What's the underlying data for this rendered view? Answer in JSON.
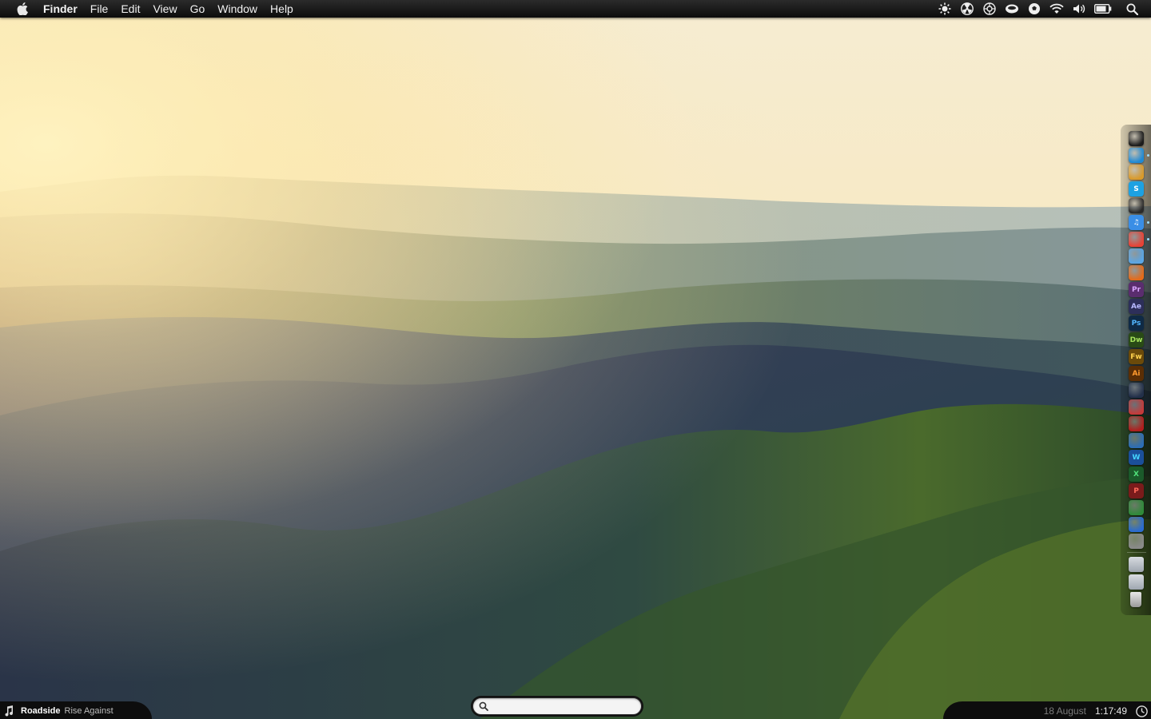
{
  "menubar": {
    "app_name": "Finder",
    "items": [
      "File",
      "Edit",
      "View",
      "Go",
      "Window",
      "Help"
    ],
    "status_icons": [
      "sun-icon",
      "radiation-icon",
      "aperture-icon",
      "cloud-drive-icon",
      "football-icon",
      "wifi-icon",
      "volume-icon",
      "battery-icon",
      "spotlight-icon"
    ]
  },
  "dock": {
    "apps": [
      {
        "name": "apple-icon",
        "label": "",
        "bg": "#1c1c1c",
        "fg": "#ffffff"
      },
      {
        "name": "send-arrow-icon",
        "label": "",
        "bg": "#1e8ad6",
        "fg": "#ffffff",
        "running": true
      },
      {
        "name": "network-icon",
        "label": "",
        "bg": "#d99a2b",
        "fg": "#ffffff"
      },
      {
        "name": "skype-icon",
        "label": "S",
        "bg": "#1da1e2",
        "fg": "#ffffff"
      },
      {
        "name": "film-reel-icon",
        "label": "",
        "bg": "#2a2a2a",
        "fg": "#ffffff"
      },
      {
        "name": "itunes-icon",
        "label": "♫",
        "bg": "#3a8ee6",
        "fg": "#ffffff",
        "running": true
      },
      {
        "name": "chrome-icon",
        "label": "",
        "bg": "#e94235",
        "fg": "#ffffff",
        "running": true
      },
      {
        "name": "safari-icon",
        "label": "",
        "bg": "#5aa6e6",
        "fg": "#ffffff"
      },
      {
        "name": "firefox-icon",
        "label": "",
        "bg": "#e46b1a",
        "fg": "#ffffff"
      },
      {
        "name": "premiere-icon",
        "label": "Pr",
        "bg": "#5a2d6e",
        "fg": "#d9a6ff"
      },
      {
        "name": "after-effects-icon",
        "label": "Ae",
        "bg": "#2d2f5a",
        "fg": "#b7b9ff"
      },
      {
        "name": "photoshop-icon",
        "label": "Ps",
        "bg": "#0f2a45",
        "fg": "#52b6ff"
      },
      {
        "name": "dreamweaver-icon",
        "label": "Dw",
        "bg": "#294a16",
        "fg": "#a6e35c"
      },
      {
        "name": "fireworks-icon",
        "label": "Fw",
        "bg": "#6b4a0a",
        "fg": "#ffd14d"
      },
      {
        "name": "illustrator-icon",
        "label": "Ai",
        "bg": "#5a2e05",
        "fg": "#ff9a2e"
      },
      {
        "name": "quicktime-icon",
        "label": "",
        "bg": "#23304a",
        "fg": "#ffffff"
      },
      {
        "name": "photo-booth-icon",
        "label": "",
        "bg": "#c43a3a",
        "fg": "#ffffff"
      },
      {
        "name": "stamp-icon",
        "label": "",
        "bg": "#b01e1e",
        "fg": "#ffffff"
      },
      {
        "name": "stacks-icon",
        "label": "",
        "bg": "#2c6db5",
        "fg": "#ffffff"
      },
      {
        "name": "word-icon",
        "label": "W",
        "bg": "#1b4f9a",
        "fg": "#45d6ff"
      },
      {
        "name": "excel-icon",
        "label": "X",
        "bg": "#1b5a2a",
        "fg": "#50e07a"
      },
      {
        "name": "powerpoint-icon",
        "label": "P",
        "bg": "#7a1b1b",
        "fg": "#ff6a5a"
      },
      {
        "name": "money-icon",
        "label": "",
        "bg": "#2f8a3a",
        "fg": "#ffffff"
      },
      {
        "name": "xcode-icon",
        "label": "",
        "bg": "#2a6bd0",
        "fg": "#ffffff"
      },
      {
        "name": "system-preferences-icon",
        "label": "",
        "bg": "#8a8a8a",
        "fg": "#ffffff"
      }
    ],
    "folders": [
      {
        "name": "documents-folder-icon"
      },
      {
        "name": "downloads-folder-icon"
      },
      {
        "name": "trash-icon"
      }
    ]
  },
  "now_playing": {
    "song": "Roadside",
    "artist": "Rise Against"
  },
  "spotlight": {
    "placeholder": ""
  },
  "clock": {
    "date": "18 August",
    "time": "1:17:49"
  }
}
